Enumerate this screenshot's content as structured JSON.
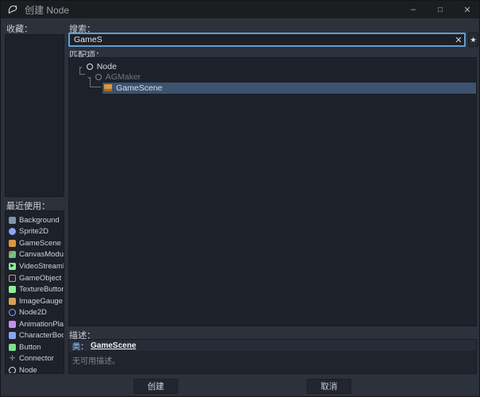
{
  "window": {
    "title": "创建 Node",
    "controls": {
      "minimize": "–",
      "maximize": "□",
      "close": "✕"
    }
  },
  "colors": {
    "accent_focus": "#5d9fd2",
    "selection": "#3b536f",
    "titlebar": "#1b1d21",
    "dialog_bg": "#2c313c",
    "panel_bg": "#1d212a"
  },
  "left": {
    "favorites_label": "收藏：",
    "recent_label": "最近使用：",
    "recent_items": [
      {
        "label": "Background",
        "icon": "background-icon",
        "shape": "square",
        "color": "#7e94ad"
      },
      {
        "label": "Sprite2D",
        "icon": "sprite2d-icon",
        "shape": "circle",
        "color": "#8ba6f0"
      },
      {
        "label": "GameScene",
        "icon": "gamescene-icon",
        "shape": "square",
        "color": "#dd9640"
      },
      {
        "label": "CanvasModul…",
        "icon": "canvasmodulate-icon",
        "shape": "gradient",
        "gradient": [
          "#e05252",
          "#6fcf6f",
          "#5aa0e0"
        ]
      },
      {
        "label": "VideoStreamP…",
        "icon": "videostreamplayer-icon",
        "shape": "play",
        "color": "#8eef97",
        "glyph": "▶"
      },
      {
        "label": "GameObject",
        "icon": "gameobject-icon",
        "shape": "ring-square",
        "color": "#e09a57"
      },
      {
        "label": "TextureButton",
        "icon": "texturebutton-icon",
        "shape": "square",
        "color": "#8eef97"
      },
      {
        "label": "ImageGauge",
        "icon": "imagegauge-icon",
        "shape": "square",
        "color": "#d9a05b"
      },
      {
        "label": "Node2D",
        "icon": "node2d-icon",
        "shape": "ring",
        "color": "#8ba6f0"
      },
      {
        "label": "AnimationPlay…",
        "icon": "animationplayer-icon",
        "shape": "square",
        "color": "#c88ef1"
      },
      {
        "label": "CharacterBod…",
        "icon": "characterbody2d-icon",
        "shape": "square",
        "color": "#8ba6f0"
      },
      {
        "label": "Button",
        "icon": "button-icon",
        "shape": "square",
        "color": "#7ee08a"
      },
      {
        "label": "Connector",
        "icon": "connector-icon",
        "shape": "cross",
        "color": "#9aa0a8",
        "glyph": "✛"
      },
      {
        "label": "Node",
        "icon": "node-icon",
        "shape": "ring",
        "color": "#e6e6e6"
      }
    ]
  },
  "search": {
    "label": "搜索：",
    "value": "GameS",
    "clear_glyph": "✕",
    "favorite_glyph": "★"
  },
  "matches": {
    "label": "匹配项：",
    "tree": [
      {
        "label": "Node",
        "depth": 0,
        "dimmed": false,
        "selected": false
      },
      {
        "label": "AGMaker",
        "depth": 1,
        "dimmed": true,
        "selected": false
      },
      {
        "label": "GameScene",
        "depth": 2,
        "dimmed": false,
        "selected": true
      }
    ],
    "expand_glyph": "⌄"
  },
  "description": {
    "label": "描述：",
    "class_prefix": "类：",
    "class_name": "GameScene",
    "body": "无可用描述。"
  },
  "footer": {
    "create_label": "创建",
    "cancel_label": "取消"
  }
}
